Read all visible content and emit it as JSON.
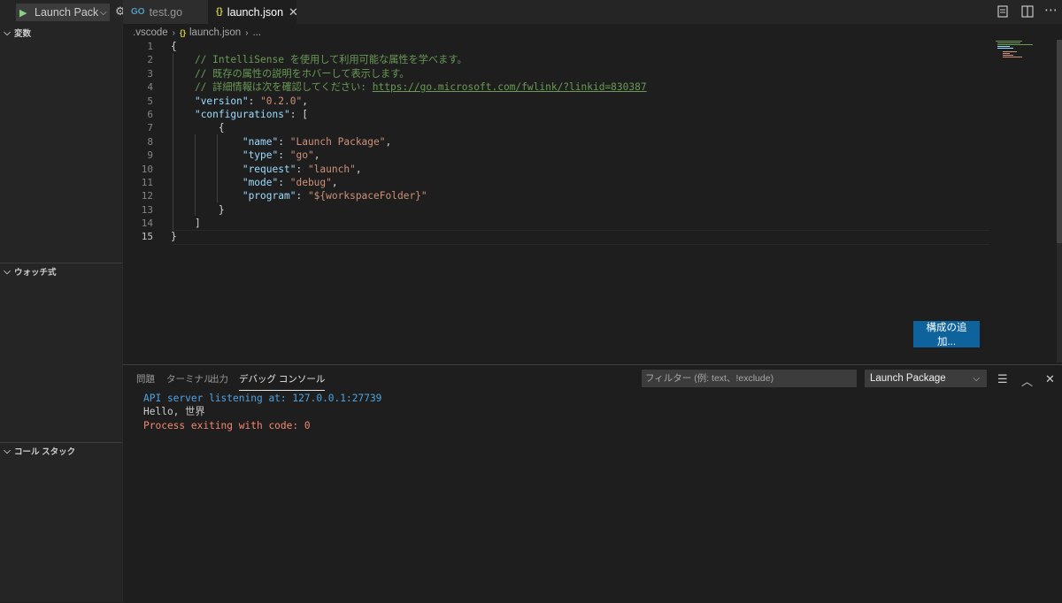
{
  "debug_toolbar": {
    "config_label": "Launch Package",
    "play_icon": "play-icon",
    "gear_icon": "gear-icon"
  },
  "tabs": [
    {
      "icon_text": "GO",
      "label": "test.go",
      "active": false
    },
    {
      "icon_text": "{}",
      "label": "launch.json",
      "active": true,
      "close": "✕"
    }
  ],
  "editor_actions": [
    "compare-icon",
    "split-editor-icon",
    "more-icon"
  ],
  "sidebar": {
    "sections": [
      {
        "label": "変数",
        "expanded": true
      },
      {
        "label": "ウォッチ式",
        "expanded": true
      },
      {
        "label": "コール スタック",
        "expanded": true
      }
    ]
  },
  "breadcrumb": {
    "folder": ".vscode",
    "file_icon": "{}",
    "file": "launch.json",
    "more": "..."
  },
  "editor": {
    "current_line": 15,
    "lines": [
      "{",
      "    // IntelliSense を使用して利用可能な属性を学べます。",
      "    // 既存の属性の説明をホバーして表示します。",
      "    // 詳細情報は次を確認してください: https://go.microsoft.com/fwlink/?linkid=830387",
      "    \"version\": \"0.2.0\",",
      "    \"configurations\": [",
      "        {",
      "            \"name\": \"Launch Package\",",
      "            \"type\": \"go\",",
      "            \"request\": \"launch\",",
      "            \"mode\": \"debug\",",
      "            \"program\": \"${workspaceFolder}\"",
      "        }",
      "    ]",
      "}"
    ],
    "line_numbers": [
      "1",
      "2",
      "3",
      "4",
      "5",
      "6",
      "7",
      "8",
      "9",
      "10",
      "11",
      "12",
      "13",
      "14",
      "15"
    ]
  },
  "add_config_button": "構成の追加...",
  "panel": {
    "tabs": [
      {
        "label": "問題",
        "active": false
      },
      {
        "label": "ターミナル",
        "active": false
      },
      {
        "label": "出力",
        "active": false
      },
      {
        "label": "デバッグ コンソール",
        "active": true
      }
    ],
    "filter_placeholder": "フィルター (例: text、!exclude)",
    "config_select": "Launch Package",
    "icons": [
      "collapse-all-icon",
      "maximize-panel-icon",
      "close-panel-icon"
    ],
    "console_lines": [
      {
        "text": "API server listening at: 127.0.0.1:27739",
        "kind": "info"
      },
      {
        "text": "Hello, 世界",
        "kind": "out"
      },
      {
        "text": "Process exiting with code: 0",
        "kind": "err"
      }
    ]
  },
  "colors": {
    "editor_bg": "#1e1e1e",
    "sidebar_bg": "#252526",
    "accent_button": "#0e639c",
    "comment": "#6a9955",
    "key": "#9cdcfe",
    "string": "#ce9178",
    "console_info": "#4fa3e0",
    "console_error": "#f48771"
  }
}
